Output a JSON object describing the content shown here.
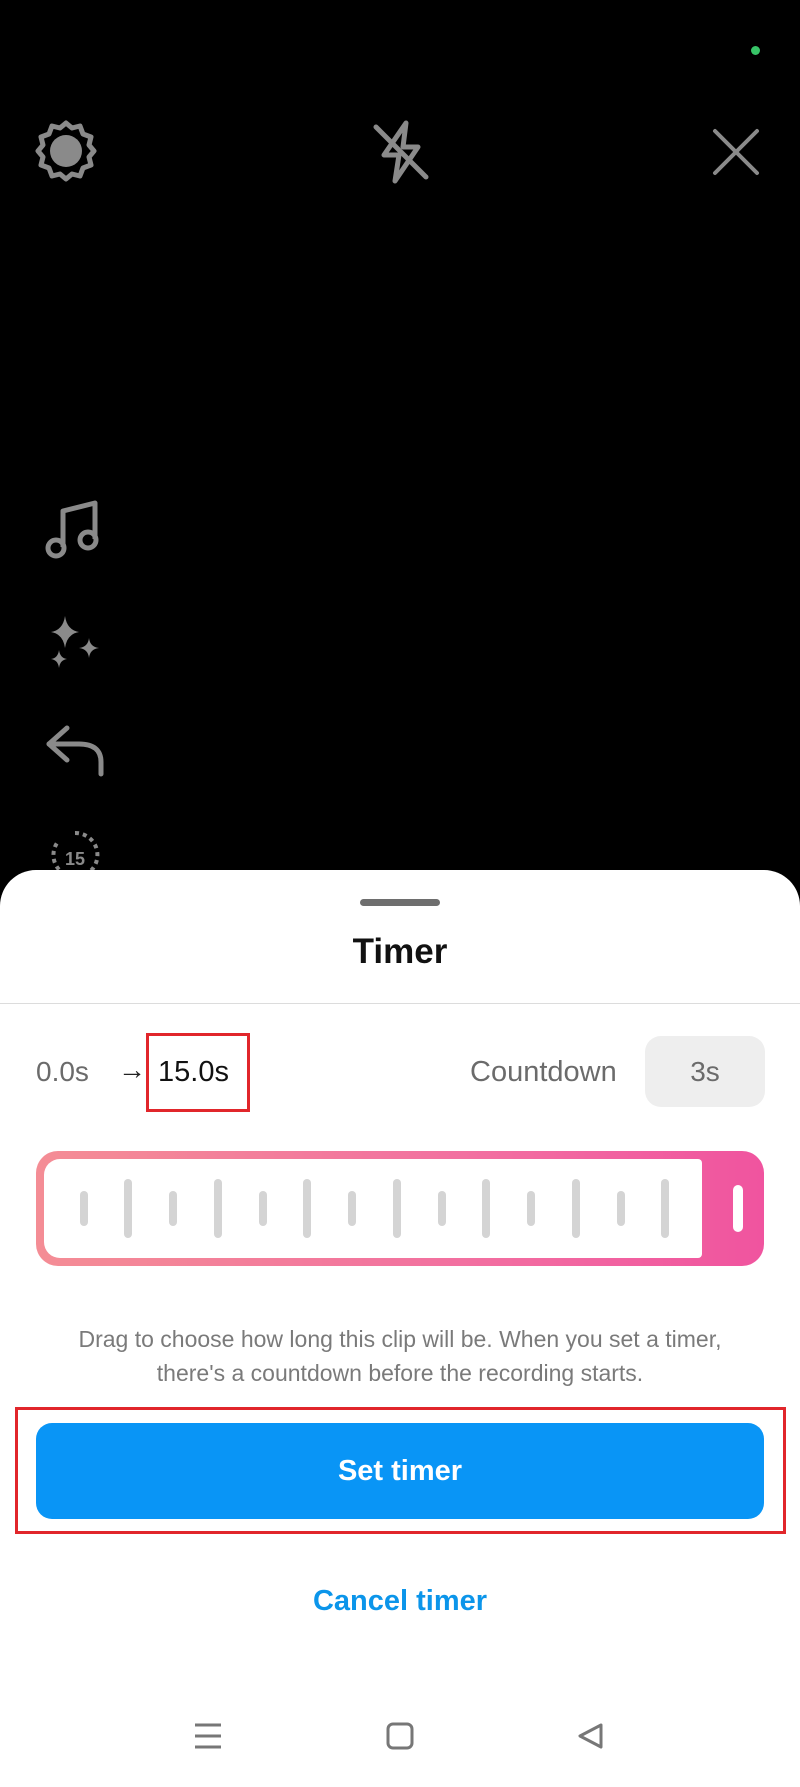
{
  "camera": {
    "icons": [
      "settings-icon",
      "flash-off-icon",
      "close-icon",
      "music-icon",
      "effects-icon",
      "undo-icon",
      "timer-icon"
    ],
    "timer_badge": "15"
  },
  "sheet": {
    "title": "Timer",
    "start_time": "0.0s",
    "arrow": "→",
    "end_time": "15.0s",
    "countdown_label": "Countdown",
    "countdown_value": "3s",
    "slider": {
      "fill_fraction": 1.0
    },
    "help_text": "Drag to choose how long this clip will be. When you set a timer, there's a countdown before the recording starts.",
    "set_button": "Set timer",
    "cancel_button": "Cancel timer"
  },
  "colors": {
    "accent_blue": "#0995f6",
    "highlight_red": "#e1262b",
    "slider_pink": "#f0549f",
    "status_green": "#37c467"
  },
  "navbar": {
    "icons": [
      "menu-icon",
      "home-icon",
      "back-icon"
    ]
  }
}
